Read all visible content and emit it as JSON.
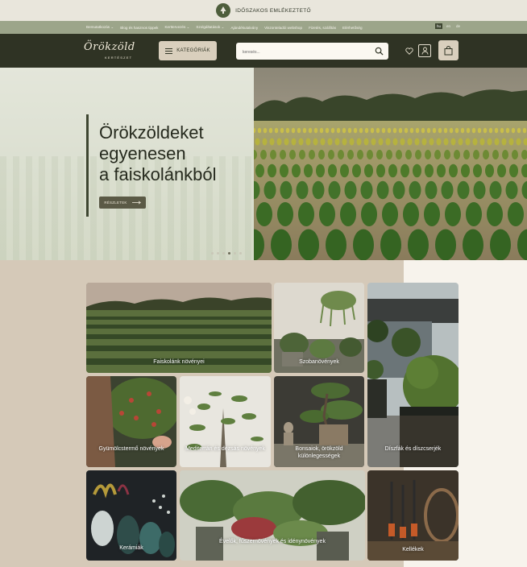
{
  "announcement": {
    "text": "IDŐSZAKOS EMLÉKEZTETŐ",
    "icon": "tree-badge-icon"
  },
  "nav": {
    "items": [
      "Bemutatkozás ⌄",
      "Blog és hasznos tippek",
      "Kerttervezés ⌄",
      "Szolgáltatások ⌄",
      "Ajándékutalvány",
      "Viszonteladói webshop",
      "Fizetés, szállítás",
      "Elérhetőség"
    ],
    "languages": [
      "hu",
      "en",
      "de"
    ],
    "active_language": "hu"
  },
  "header": {
    "logo_main": "Örökzöld",
    "logo_sub": "KERTÉSZET",
    "categories_label": "KATEGÓRIÁK",
    "search_placeholder": "keresés..."
  },
  "hero": {
    "title_lines": [
      "Örökzöldeket",
      "egyenesen",
      "a faiskolánkból"
    ],
    "button_label": "RÉSZLETEK",
    "slides": 6,
    "active_slide": 4
  },
  "categories": [
    {
      "label": "Faiskolánk növényei",
      "icon": "nursery-field"
    },
    {
      "label": "Szobanövények",
      "icon": "houseplants"
    },
    {
      "label": "Díszfák és díszcserjék",
      "icon": "topiary"
    },
    {
      "label": "Gyümölcstermő növények",
      "icon": "fruit-tree"
    },
    {
      "label": "Mediterrán és dézsás növények",
      "icon": "olive-plant"
    },
    {
      "label": "Bonsaiok, örökzöld különlegességek",
      "icon": "bonsai"
    },
    {
      "label": "Kerámiák",
      "icon": "ceramic-vases"
    },
    {
      "label": "Évelők, fűszernövények és idénynövények",
      "icon": "perennials"
    },
    {
      "label": "Kellékek",
      "icon": "garden-tools"
    }
  ],
  "colors": {
    "header_bg": "#2f3324",
    "nav_bg": "#9ca58a",
    "accent": "#d9cfbd",
    "section_bg": "#d5c9b8"
  }
}
